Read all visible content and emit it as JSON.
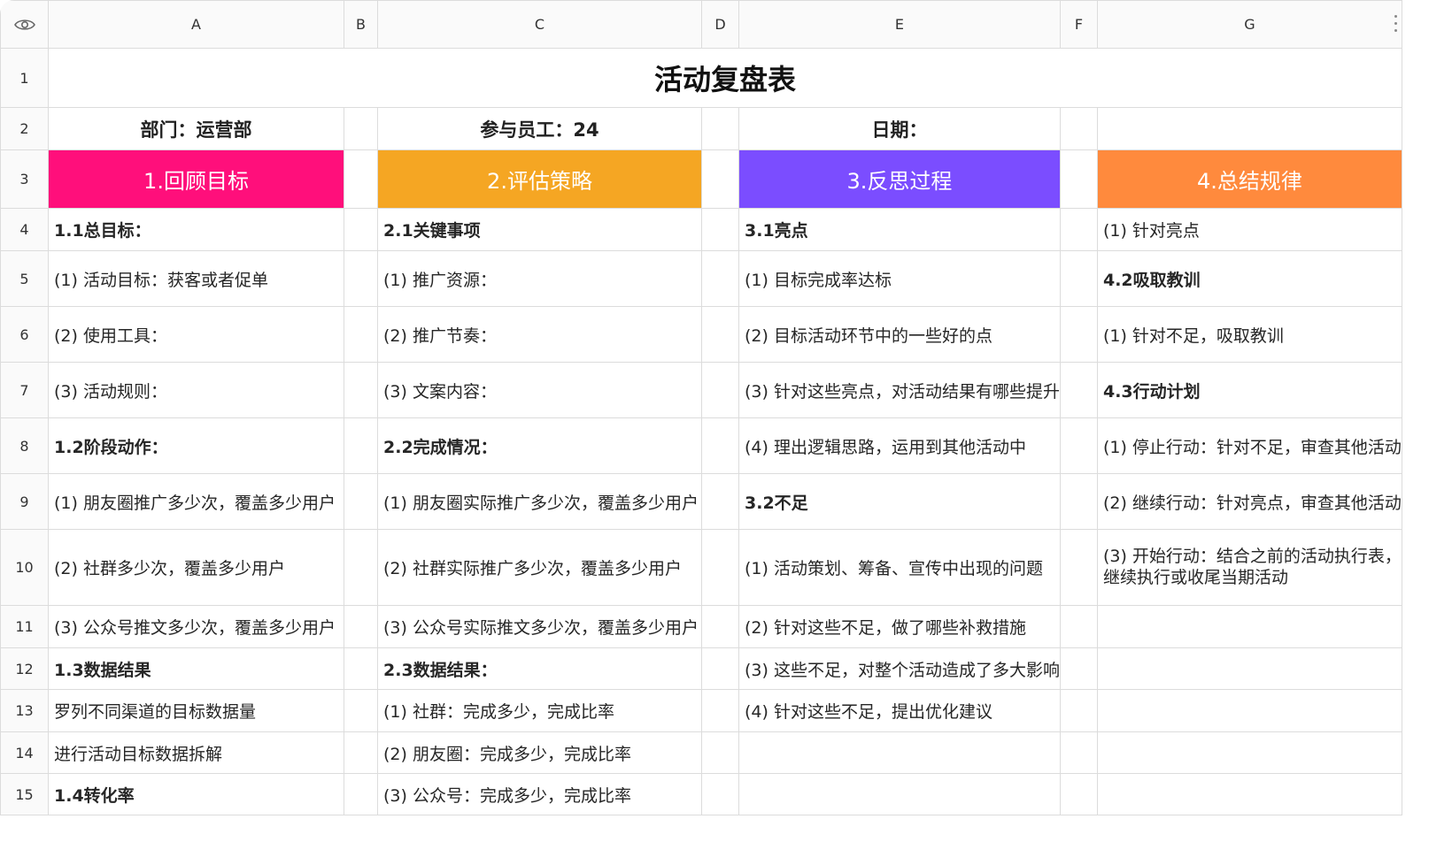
{
  "columns": [
    "A",
    "B",
    "C",
    "D",
    "E",
    "F",
    "G"
  ],
  "rows": [
    "1",
    "2",
    "3",
    "4",
    "5",
    "6",
    "7",
    "8",
    "9",
    "10",
    "11",
    "12",
    "13",
    "14",
    "15"
  ],
  "title": "活动复盘表",
  "meta": {
    "dept": "部门：运营部",
    "staff": "参与员工：24",
    "date": "日期："
  },
  "sections": [
    {
      "label": "1.回顾目标",
      "color": "#ff0f7b"
    },
    {
      "label": "2.评估策略",
      "color": "#f5a623"
    },
    {
      "label": "3.反思过程",
      "color": "#7b4dff"
    },
    {
      "label": "4.总结规律",
      "color": "#ff8a3d"
    }
  ],
  "cells": {
    "A": [
      "1.1总目标：",
      "(1) 活动目标：获客或者促单",
      "(2) 使用工具：",
      "(3) 活动规则：",
      "1.2阶段动作：",
      "(1) 朋友圈推广多少次，覆盖多少用户",
      "(2) 社群多少次，覆盖多少用户",
      "(3) 公众号推文多少次，覆盖多少用户",
      "1.3数据结果",
      "罗列不同渠道的目标数据量",
      "进行活动目标数据拆解",
      "1.4转化率"
    ],
    "C": [
      "2.1关键事项",
      "(1) 推广资源：",
      "(2) 推广节奏：",
      "(3) 文案内容：",
      "2.2完成情况：",
      "(1) 朋友圈实际推广多少次，覆盖多少用户",
      "(2) 社群实际推广多少次，覆盖多少用户",
      "(3) 公众号实际推文多少次，覆盖多少用户",
      "2.3数据结果：",
      "(1) 社群：完成多少，完成比率",
      "(2) 朋友圈：完成多少，完成比率",
      "(3) 公众号：完成多少，完成比率"
    ],
    "E": [
      "3.1亮点",
      "(1) 目标完成率达标",
      "(2) 目标活动环节中的一些好的点",
      "(3) 针对这些亮点，对活动结果有哪些提升",
      "(4) 理出逻辑思路，运用到其他活动中",
      "3.2不足",
      "(1) 活动策划、筹备、宣传中出现的问题",
      "(2) 针对这些不足，做了哪些补救措施",
      "(3) 这些不足，对整个活动造成了多大影响",
      "(4) 针对这些不足，提出优化建议",
      "",
      ""
    ],
    "G": [
      "(1) 针对亮点",
      "4.2吸取教训",
      "(1) 针对不足，吸取教训",
      "4.3行动计划",
      "(1) 停止行动：针对不足，审查其他活动",
      "(2) 继续行动：针对亮点，审查其他活动",
      "(3) 开始行动：结合之前的活动执行表，继续执行或收尾当期活动",
      "",
      "",
      "",
      "",
      ""
    ]
  }
}
